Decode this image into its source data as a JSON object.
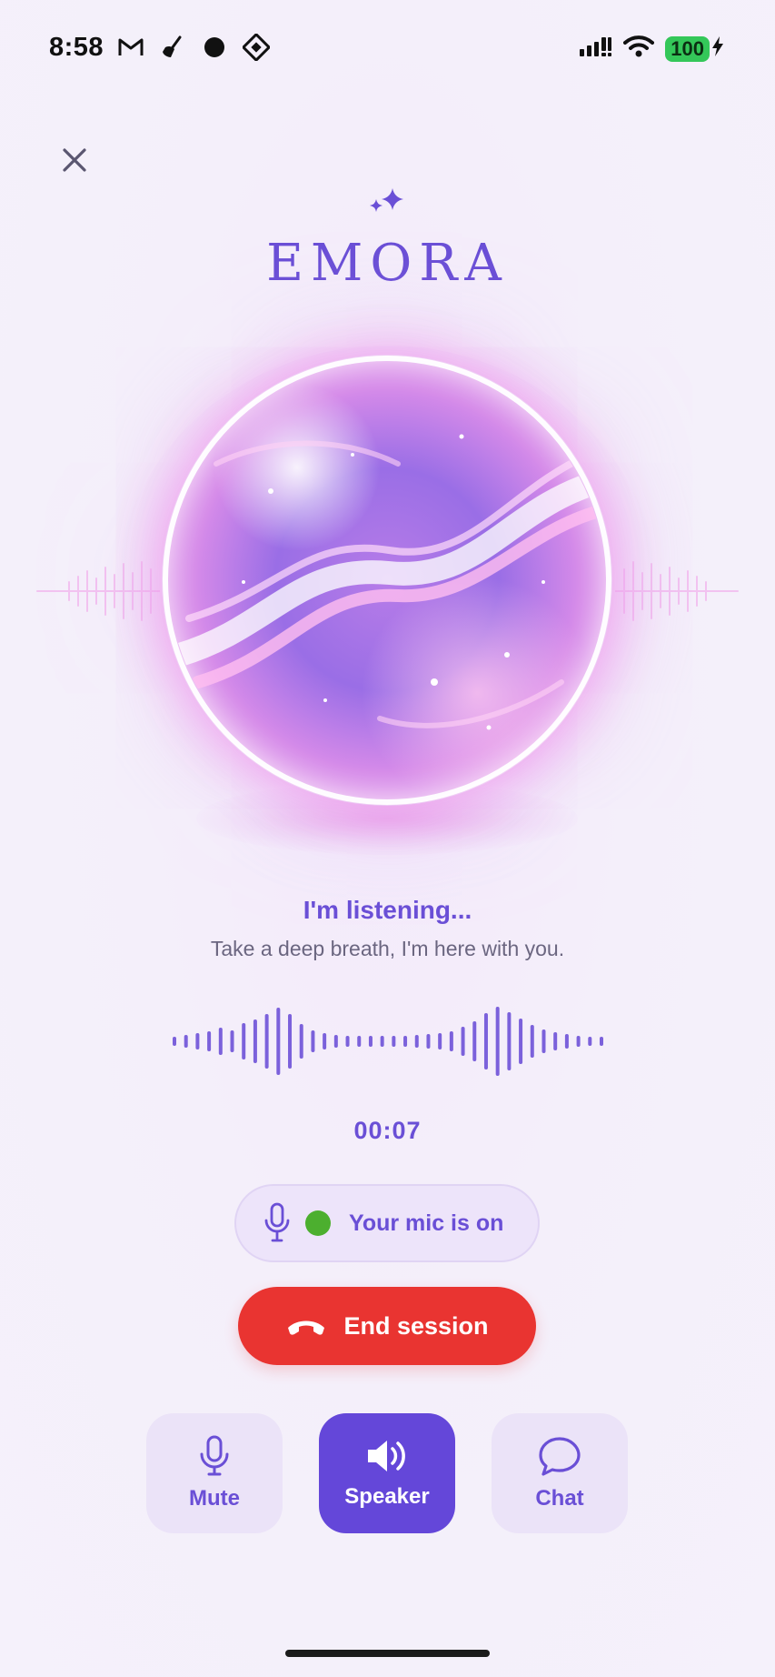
{
  "status_bar": {
    "time": "8:58",
    "battery": "100",
    "left_icons": [
      "gmail-icon",
      "broom-icon",
      "dot-icon",
      "tidal-icon"
    ],
    "right_icons": [
      "signal-icon",
      "wifi-icon",
      "battery-icon"
    ],
    "battery_color": "#34c759"
  },
  "header": {
    "close_icon": "close-icon",
    "logo": "EMORA",
    "logo_icon": "sparkles-icon"
  },
  "status": {
    "title": "I'm listening...",
    "subtitle": "Take a deep breath, I'm here with you."
  },
  "timer": "00:07",
  "mic_status": {
    "label": "Your mic is on",
    "indicator_color": "#4caf2f"
  },
  "end_session": {
    "label": "End session",
    "color": "#e93431"
  },
  "actions": [
    {
      "label": "Mute",
      "icon": "mic-icon",
      "active": false
    },
    {
      "label": "Speaker",
      "icon": "speaker-icon",
      "active": true
    },
    {
      "label": "Chat",
      "icon": "chat-bubble-icon",
      "active": false
    }
  ],
  "colors": {
    "accent": "#6a4fd6",
    "active_button": "#6447d9",
    "background": "#f5f0fb"
  }
}
